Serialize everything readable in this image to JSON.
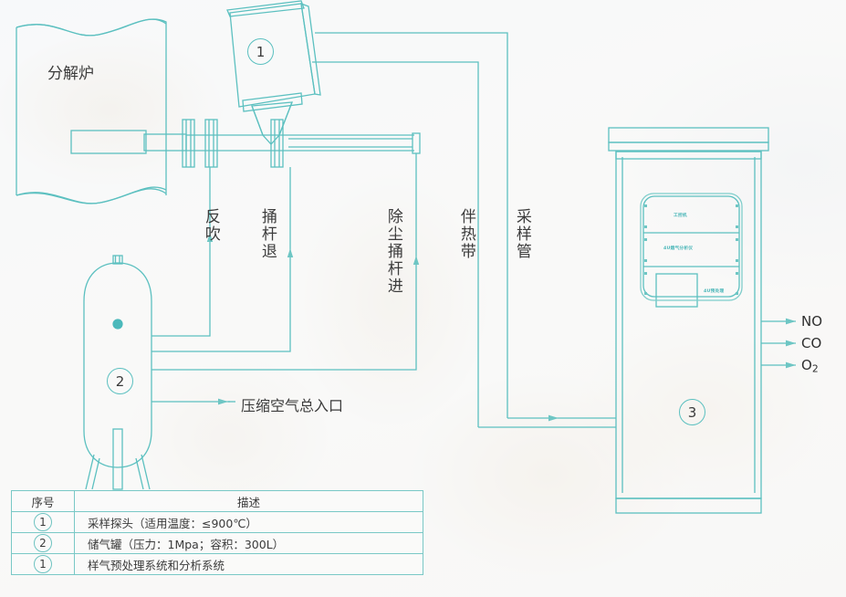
{
  "colors": {
    "line": "#5cc0c0",
    "line_dark": "#3fb3b3",
    "text": "#3c3c3c",
    "table_border": "#79c8c6",
    "background": "#f7f8f8"
  },
  "diagram": {
    "title_equipment": "分解炉",
    "vertical_labels": [
      {
        "name": "back-blow",
        "text": "反吹"
      },
      {
        "name": "rod-retract",
        "text": "捅杆退"
      },
      {
        "name": "dedust-rod-advance",
        "text": "除尘捅杆进"
      },
      {
        "name": "heat-tracing-belt",
        "text": "伴热带"
      },
      {
        "name": "sampling-tube",
        "text": "采样管"
      }
    ],
    "air_inlet_label": "压缩空气总入口",
    "gas_outputs": [
      {
        "name": "no",
        "text": "NO"
      },
      {
        "name": "co",
        "text": "CO"
      },
      {
        "name": "o2",
        "text": "O",
        "sub": "2"
      }
    ],
    "callouts": [
      {
        "name": "callout-probe",
        "text": "1"
      },
      {
        "name": "callout-air-tank",
        "text": "2"
      },
      {
        "name": "callout-cabinet",
        "text": "3"
      }
    ],
    "cabinet_modules": [
      {
        "name": "industrial-pc",
        "text": "工控机"
      },
      {
        "name": "flue-gas-analyzer",
        "text": "4U烟气分析仪"
      },
      {
        "name": "pretreatment-unit",
        "text": "4U预处理"
      }
    ]
  },
  "legend": {
    "headers": [
      "序号",
      "描述"
    ],
    "rows": [
      {
        "no": "1",
        "desc": "采样探头（适用温度：≤900℃）"
      },
      {
        "no": "2",
        "desc": "储气罐（压力：1Mpa；容积：300L）"
      },
      {
        "no": "1",
        "desc": "样气预处理系统和分析系统"
      }
    ]
  }
}
